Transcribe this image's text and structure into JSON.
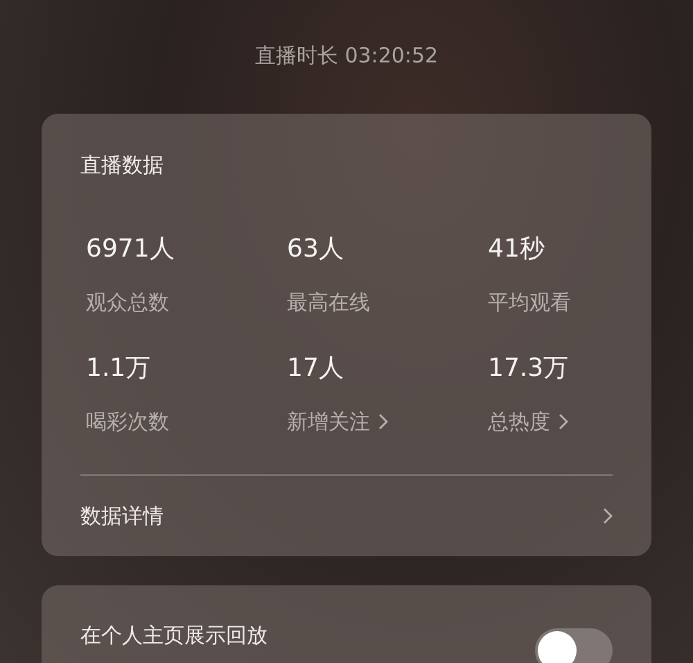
{
  "live_duration": "直播时长 03:20:52",
  "stats_card": {
    "title": "直播数据",
    "stats": [
      {
        "kind": "plain",
        "value": "6971人",
        "label": "观众总数"
      },
      {
        "kind": "plain",
        "value": "63人",
        "label": "最高在线"
      },
      {
        "kind": "plain",
        "value": "41秒",
        "label": "平均观看"
      },
      {
        "kind": "plain",
        "value": "1.1万",
        "label": "喝彩次数"
      },
      {
        "kind": "link",
        "value": "17人",
        "label": "新增关注"
      },
      {
        "kind": "link",
        "value": "17.3万",
        "label": "总热度"
      }
    ],
    "details_link": "数据详情"
  },
  "replay_setting": {
    "label": "在个人主页展示回放",
    "on": false
  }
}
